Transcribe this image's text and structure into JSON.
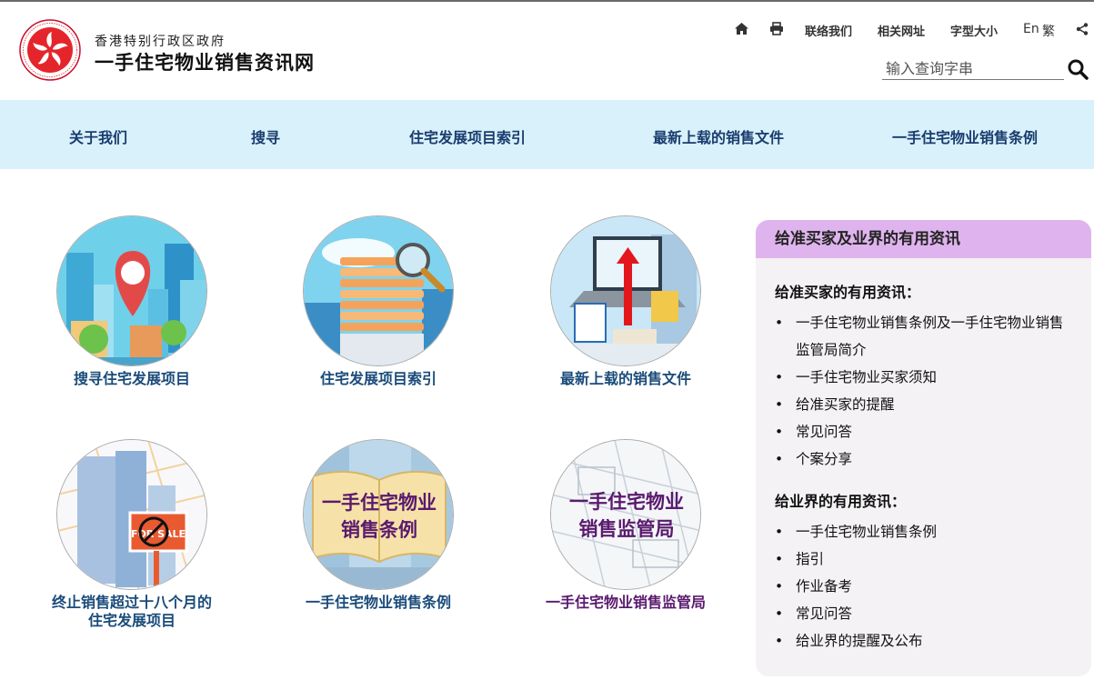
{
  "header": {
    "gov_name": "香港特别行政区政府",
    "site_name": "一手住宅物业销售资讯网",
    "links": {
      "contact": "联络我们",
      "related": "相关网址",
      "font_size": "字型大小",
      "english": "En",
      "traditional": "繁"
    },
    "icons": [
      "home-icon",
      "print-icon",
      "share-icon",
      "search-icon"
    ],
    "search_placeholder": "输入查询字串"
  },
  "nav": {
    "items": [
      "关于我们",
      "搜寻",
      "住宅发展项目索引",
      "最新上载的销售文件",
      "一手住宅物业销售条例"
    ],
    "background": "#d9f1fa",
    "text_color": "#1a3c6e"
  },
  "tiles": [
    {
      "caption": "搜寻住宅发展项目"
    },
    {
      "caption": "住宅发展项目索引"
    },
    {
      "caption": "最新上载的销售文件"
    },
    {
      "caption_line1": "终止销售超过十八个月的",
      "caption_line2": "住宅发展项目"
    },
    {
      "caption": "一手住宅物业销售条例",
      "image_text_line1": "一手住宅物业",
      "image_text_line2": "销售条例"
    },
    {
      "caption": "一手住宅物业销售监管局",
      "image_text_line1": "一手住宅物业",
      "image_text_line2": "销售监管局"
    }
  ],
  "sign_text": "FOR SALE",
  "panel": {
    "title": "给准买家及业界的有用资讯",
    "buyers": {
      "heading": "给准买家的有用资讯：",
      "items": [
        "一手住宅物业销售条例及一手住宅物业销售监管局简介",
        "一手住宅物业买家须知",
        "给准买家的提醒",
        "常见问答",
        "个案分享"
      ]
    },
    "trade": {
      "heading": "给业界的有用资讯：",
      "items": [
        "一手住宅物业销售条例",
        "指引",
        "作业备考",
        "常见问答",
        "给业界的提醒及公布"
      ]
    },
    "header_color": "#dfb4ee"
  }
}
